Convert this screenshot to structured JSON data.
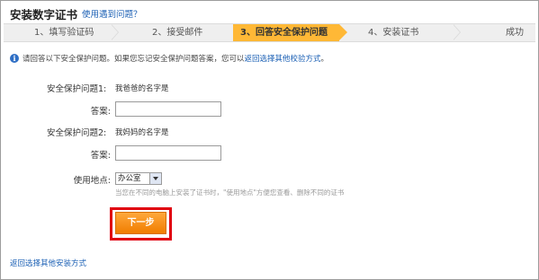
{
  "header": {
    "title": "安装数字证书",
    "help_link": "使用遇到问题？"
  },
  "steps": [
    {
      "label": "1、填写验证码"
    },
    {
      "label": "2、接受邮件"
    },
    {
      "label": "3、回答安全保护问题"
    },
    {
      "label": "4、安装证书"
    },
    {
      "label": "成功"
    }
  ],
  "info": {
    "text": "请回答以下安全保护问题。如果您忘记安全保护问题答案，您可以",
    "link": "返回选择其他校验方式",
    "suffix": "。"
  },
  "form": {
    "q1_label": "安全保护问题1:",
    "q1_value": "我爸爸的名字是",
    "answer1_label": "答案:",
    "answer1_value": "",
    "q2_label": "安全保护问题2:",
    "q2_value": "我妈妈的名字是",
    "answer2_label": "答案:",
    "answer2_value": "",
    "location_label": "使用地点:",
    "location_value": "办公室",
    "hint": "当您在不同的电脑上安装了证书时，\"使用地点\"方便您查看、删除不同的证书"
  },
  "actions": {
    "next_label": "下一步",
    "bottom_link": "返回选择其他安装方式"
  },
  "colors": {
    "active_step": "#ffb836",
    "next_button": "#f08a10",
    "highlight": "#e00010",
    "link": "#1a5fb4"
  }
}
